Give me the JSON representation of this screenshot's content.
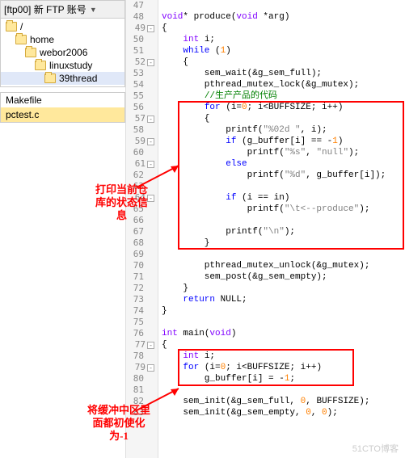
{
  "ftp": {
    "title": "[ftp00] 新 FTP 账号"
  },
  "tree": {
    "items": [
      {
        "label": "/",
        "indent": 0
      },
      {
        "label": "home",
        "indent": 1
      },
      {
        "label": "webor2006",
        "indent": 2
      },
      {
        "label": "linuxstudy",
        "indent": 3
      },
      {
        "label": "39thread",
        "indent": 4,
        "selected": true
      }
    ]
  },
  "files": {
    "items": [
      {
        "name": "Makefile",
        "selected": false
      },
      {
        "name": "pctest.c",
        "selected": true
      }
    ]
  },
  "annotations": {
    "anno1_l1": "打印当前仓",
    "anno1_l2": "库的状态信",
    "anno1_l3": "息",
    "anno2_l1": "将缓冲中区里",
    "anno2_l2": "面都初使化",
    "anno2_l3": "为-1"
  },
  "code": {
    "lines": [
      {
        "n": 47,
        "h": ""
      },
      {
        "n": 48,
        "h": "<span class='type'>void</span>* produce(<span class='type'>void</span> *arg)"
      },
      {
        "n": 49,
        "fold": "⊟",
        "h": "{"
      },
      {
        "n": 50,
        "h": "    <span class='type'>int</span> i;"
      },
      {
        "n": 51,
        "h": "    <span class='kw'>while</span> (<span class='num'>1</span>)"
      },
      {
        "n": 52,
        "fold": "⊟",
        "h": "    {"
      },
      {
        "n": 53,
        "h": "        sem_wait(&amp;g_sem_full);"
      },
      {
        "n": 54,
        "h": "        pthread_mutex_lock(&amp;g_mutex);"
      },
      {
        "n": 55,
        "h": "        <span class='com'>//生产产品的代码</span>"
      },
      {
        "n": 56,
        "h": "        <span class='kw'>for</span> (i=<span class='num'>0</span>; i&lt;BUFFSIZE; i++)"
      },
      {
        "n": 57,
        "fold": "⊟",
        "h": "        {"
      },
      {
        "n": 58,
        "h": "            printf(<span class='str'>\"%02d \"</span>, i);"
      },
      {
        "n": 59,
        "fold": "⊟",
        "h": "            <span class='kw'>if</span> (g_buffer[i] == -<span class='num'>1</span>)"
      },
      {
        "n": 60,
        "h": "                printf(<span class='str'>\"%s\"</span>, <span class='str'>\"null\"</span>);"
      },
      {
        "n": 61,
        "fold": "⊟",
        "h": "            <span class='kw'>else</span>"
      },
      {
        "n": 62,
        "h": "                printf(<span class='str'>\"%d\"</span>, g_buffer[i]);"
      },
      {
        "n": 63,
        "h": ""
      },
      {
        "n": 64,
        "fold": "⊟",
        "h": "            <span class='kw'>if</span> (i == in)"
      },
      {
        "n": 65,
        "h": "                printf(<span class='str'>\"\\t&lt;--produce\"</span>);"
      },
      {
        "n": 66,
        "h": ""
      },
      {
        "n": 67,
        "h": "            printf(<span class='str'>\"\\n\"</span>);"
      },
      {
        "n": 68,
        "h": "        }"
      },
      {
        "n": 69,
        "h": ""
      },
      {
        "n": 70,
        "h": "        pthread_mutex_unlock(&amp;g_mutex);"
      },
      {
        "n": 71,
        "h": "        sem_post(&amp;g_sem_empty);"
      },
      {
        "n": 72,
        "h": "    }"
      },
      {
        "n": 73,
        "h": "    <span class='kw'>return</span> NULL;"
      },
      {
        "n": 74,
        "h": "}"
      },
      {
        "n": 75,
        "h": ""
      },
      {
        "n": 76,
        "h": "<span class='type'>int</span> main(<span class='type'>void</span>)"
      },
      {
        "n": 77,
        "fold": "⊟",
        "h": "{"
      },
      {
        "n": 78,
        "h": "    <span class='type'>int</span> i;"
      },
      {
        "n": 79,
        "fold": "⊟",
        "h": "    <span class='kw'>for</span> (i=<span class='num'>0</span>; i&lt;BUFFSIZE; i++)"
      },
      {
        "n": 80,
        "h": "        g_buffer[i] = -<span class='num'>1</span>;"
      },
      {
        "n": 81,
        "h": ""
      },
      {
        "n": 82,
        "h": "    sem_init(&amp;g_sem_full, <span class='num'>0</span>, BUFFSIZE);"
      },
      {
        "n": 83,
        "h": "    sem_init(&amp;g_sem_empty, <span class='num'>0</span>, <span class='num'>0</span>);"
      }
    ]
  },
  "watermark": "51CTO博客"
}
